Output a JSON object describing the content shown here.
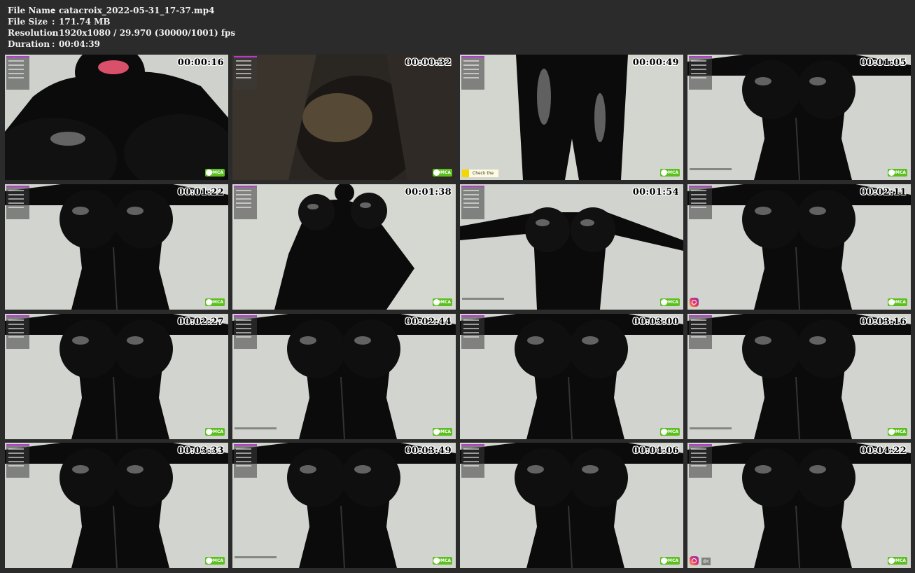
{
  "file_info": {
    "file_name_label": "File Name",
    "file_name": "catacroix_2022-05-31_17-37.mp4",
    "file_size_label": "File Size",
    "file_size": "171.74 MB",
    "resolution_label": "Resolution",
    "resolution": "1920x1080 / 29.970 (30000/1001) fps",
    "duration_label": "Duration",
    "duration": "00:04:39",
    "separator": ":"
  },
  "thumbnails": [
    {
      "timestamp": "00:00:16",
      "badge": "DMCA"
    },
    {
      "timestamp": "00:00:32",
      "badge": "DMCA"
    },
    {
      "timestamp": "00:00:49",
      "badge": "DMCA",
      "overlay_text": "Check the"
    },
    {
      "timestamp": "00:01:05",
      "badge": "DMCA"
    },
    {
      "timestamp": "00:01:22",
      "badge": "DMCA"
    },
    {
      "timestamp": "00:01:38",
      "badge": "DMCA"
    },
    {
      "timestamp": "00:01:54",
      "badge": "DMCA"
    },
    {
      "timestamp": "00:02:11",
      "badge": "DMCA"
    },
    {
      "timestamp": "00:02:27",
      "badge": "DMCA"
    },
    {
      "timestamp": "00:02:44",
      "badge": "DMCA"
    },
    {
      "timestamp": "00:03:00",
      "badge": "DMCA"
    },
    {
      "timestamp": "00:03:16",
      "badge": "DMCA"
    },
    {
      "timestamp": "00:03:33",
      "badge": "DMCA"
    },
    {
      "timestamp": "00:03:49",
      "badge": "DMCA"
    },
    {
      "timestamp": "00:04:06",
      "badge": "DMCA"
    },
    {
      "timestamp": "00:04:22",
      "badge": "DMCA",
      "overlay_text": "@c"
    }
  ],
  "colors": {
    "background": "#2b2b2b",
    "badge_green": "#5bbf1e",
    "panel_accent": "#b63bd1"
  }
}
